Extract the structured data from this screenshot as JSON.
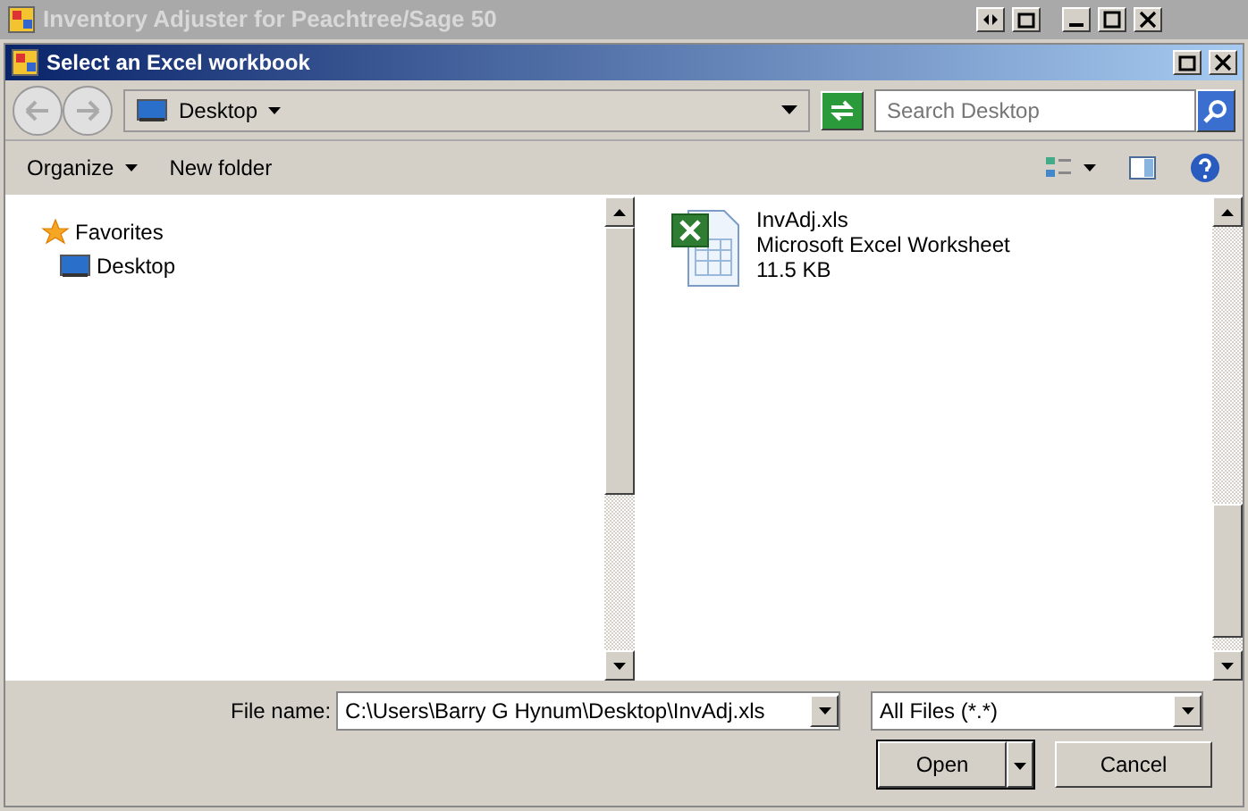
{
  "app_window": {
    "title": "Inventory Adjuster for Peachtree/Sage 50"
  },
  "dialog": {
    "title": "Select an Excel workbook"
  },
  "address_bar": {
    "location": "Desktop",
    "search": {
      "placeholder": "Search Desktop"
    }
  },
  "toolbar": {
    "organize": "Organize",
    "new_folder": "New folder"
  },
  "navigation": [
    {
      "label": "Favorites",
      "kind": "star",
      "children": [
        {
          "label": "Desktop",
          "kind": "desktop"
        }
      ]
    }
  ],
  "files": [
    {
      "name": "InvAdj.xls",
      "type": "Microsoft Excel Worksheet",
      "size": "11.5 KB"
    }
  ],
  "file_name": {
    "label": "File name:",
    "value": "C:\\Users\\Barry G Hynum\\Desktop\\InvAdj.xls"
  },
  "file_type": "All Files (*.*)",
  "buttons": {
    "open": "Open",
    "cancel": "Cancel"
  }
}
